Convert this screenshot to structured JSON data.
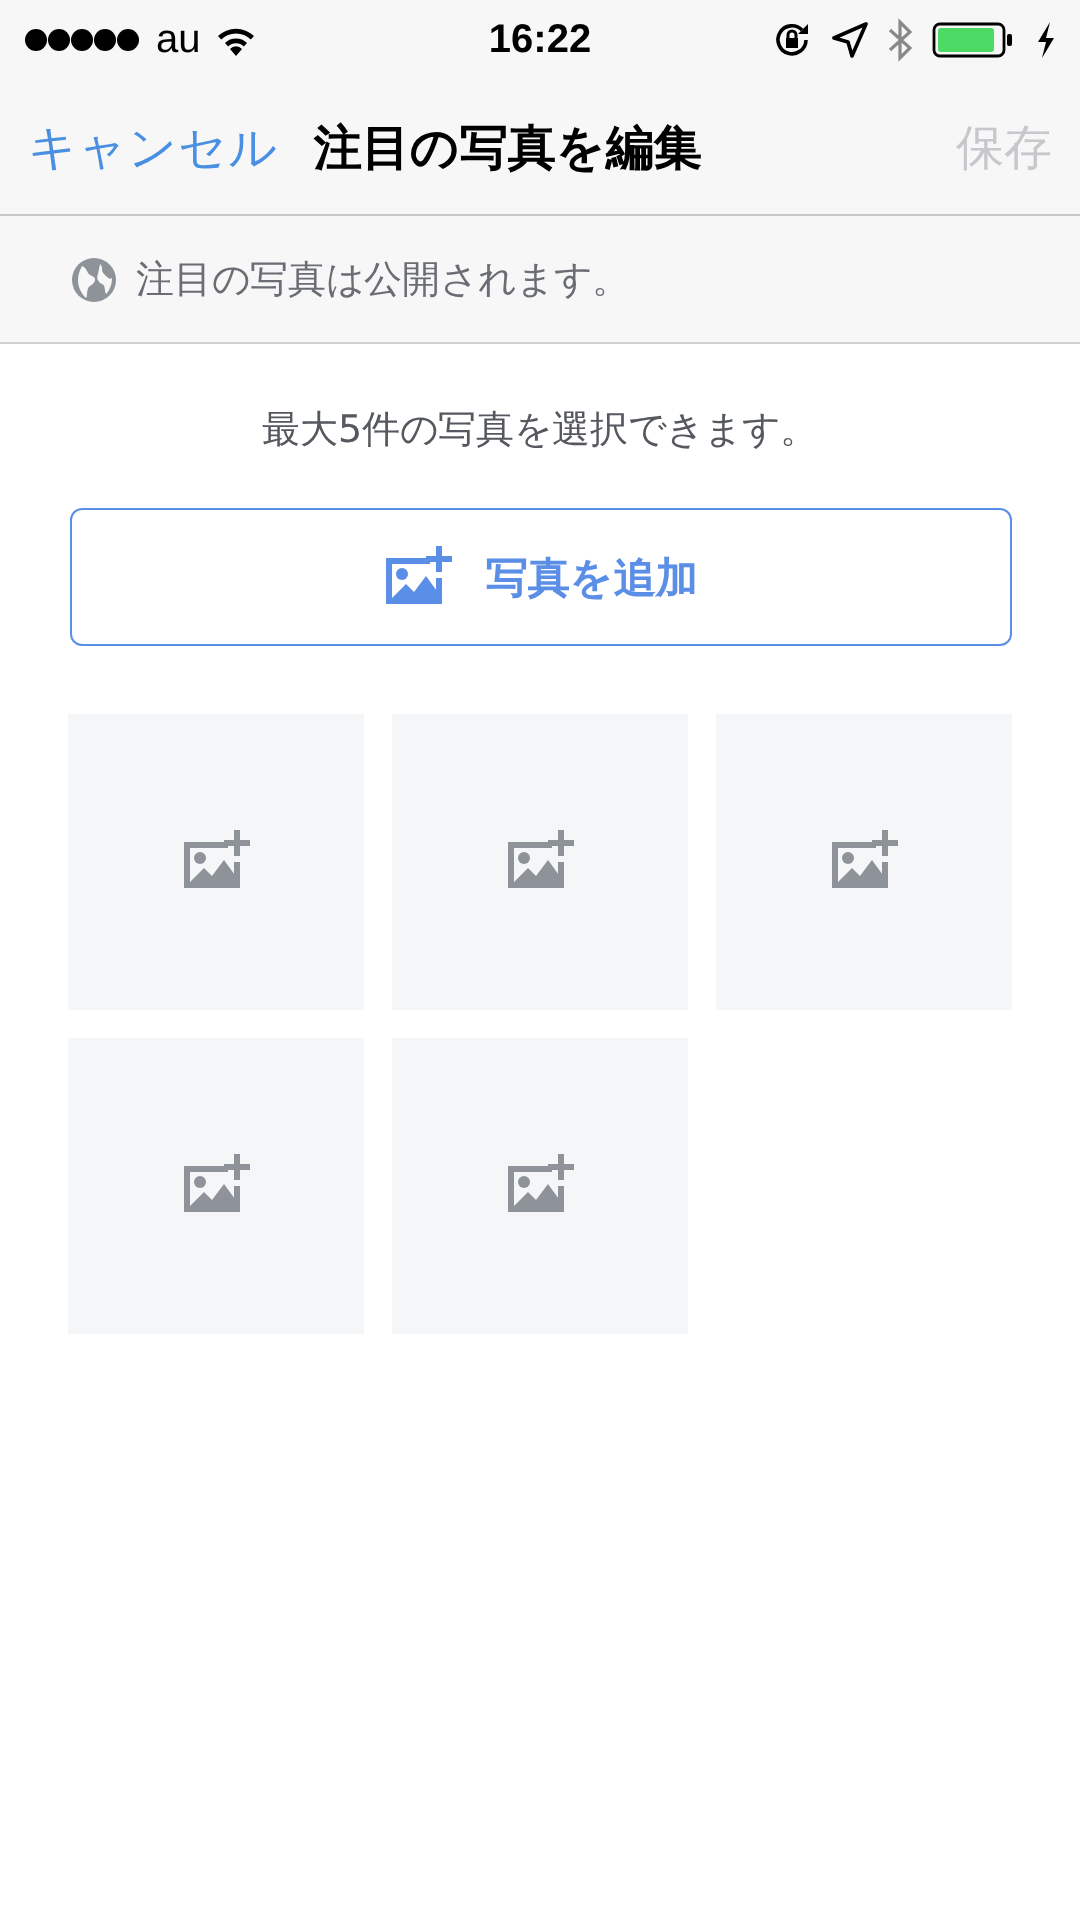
{
  "status_bar": {
    "carrier": "au",
    "time": "16:22"
  },
  "nav_bar": {
    "cancel": "キャンセル",
    "title": "注目の写真を編集",
    "save": {
      "label": "保存",
      "disabled": true
    }
  },
  "notice": "注目の写真は公開されます。",
  "hint": "最大5件の写真を選択できます。",
  "add_button": "写真を追加",
  "photo_slots": [
    {
      "kind": "empty"
    },
    {
      "kind": "empty"
    },
    {
      "kind": "empty"
    },
    {
      "kind": "empty"
    },
    {
      "kind": "empty"
    }
  ]
}
